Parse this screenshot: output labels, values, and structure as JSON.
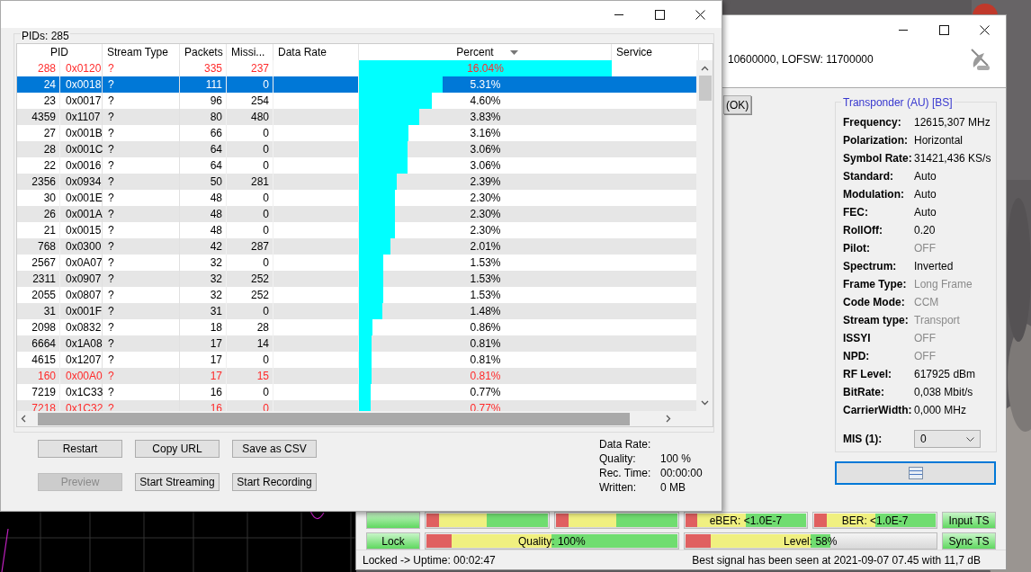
{
  "pid_window": {
    "group_label": "PIDs: 285",
    "columns": [
      {
        "label": "PID"
      },
      {
        "label": "Stream Type"
      },
      {
        "label": "Packets"
      },
      {
        "label": "Missi..."
      },
      {
        "label": "Data Rate"
      },
      {
        "label": "Percent",
        "sorted": true
      },
      {
        "label": "Service"
      }
    ],
    "rows": [
      {
        "pid": "288",
        "hex": "0x0120",
        "stream_type": "?",
        "packets": "335",
        "missing": "237",
        "percent": "16.04%",
        "level": 1,
        "alert": true,
        "selected": false
      },
      {
        "pid": "24",
        "hex": "0x0018",
        "stream_type": "?",
        "packets": "111",
        "missing": "0",
        "percent": "5.31%",
        "level": 0.331,
        "alert": false,
        "selected": true
      },
      {
        "pid": "23",
        "hex": "0x0017",
        "stream_type": "?",
        "packets": "96",
        "missing": "254",
        "percent": "4.60%",
        "level": 0.287,
        "alert": false,
        "selected": false
      },
      {
        "pid": "4359",
        "hex": "0x1107",
        "stream_type": "?",
        "packets": "80",
        "missing": "480",
        "percent": "3.83%",
        "level": 0.239,
        "alert": false,
        "selected": false
      },
      {
        "pid": "27",
        "hex": "0x001B",
        "stream_type": "?",
        "packets": "66",
        "missing": "0",
        "percent": "3.16%",
        "level": 0.197,
        "alert": false,
        "selected": false
      },
      {
        "pid": "28",
        "hex": "0x001C",
        "stream_type": "?",
        "packets": "64",
        "missing": "0",
        "percent": "3.06%",
        "level": 0.191,
        "alert": false,
        "selected": false
      },
      {
        "pid": "22",
        "hex": "0x0016",
        "stream_type": "?",
        "packets": "64",
        "missing": "0",
        "percent": "3.06%",
        "level": 0.191,
        "alert": false,
        "selected": false
      },
      {
        "pid": "2356",
        "hex": "0x0934",
        "stream_type": "?",
        "packets": "50",
        "missing": "281",
        "percent": "2.39%",
        "level": 0.149,
        "alert": false,
        "selected": false
      },
      {
        "pid": "30",
        "hex": "0x001E",
        "stream_type": "?",
        "packets": "48",
        "missing": "0",
        "percent": "2.30%",
        "level": 0.143,
        "alert": false,
        "selected": false
      },
      {
        "pid": "26",
        "hex": "0x001A",
        "stream_type": "?",
        "packets": "48",
        "missing": "0",
        "percent": "2.30%",
        "level": 0.143,
        "alert": false,
        "selected": false
      },
      {
        "pid": "21",
        "hex": "0x0015",
        "stream_type": "?",
        "packets": "48",
        "missing": "0",
        "percent": "2.30%",
        "level": 0.143,
        "alert": false,
        "selected": false
      },
      {
        "pid": "768",
        "hex": "0x0300",
        "stream_type": "?",
        "packets": "42",
        "missing": "287",
        "percent": "2.01%",
        "level": 0.125,
        "alert": false,
        "selected": false
      },
      {
        "pid": "2567",
        "hex": "0x0A07",
        "stream_type": "?",
        "packets": "32",
        "missing": "0",
        "percent": "1.53%",
        "level": 0.095,
        "alert": false,
        "selected": false
      },
      {
        "pid": "2311",
        "hex": "0x0907",
        "stream_type": "?",
        "packets": "32",
        "missing": "252",
        "percent": "1.53%",
        "level": 0.095,
        "alert": false,
        "selected": false
      },
      {
        "pid": "2055",
        "hex": "0x0807",
        "stream_type": "?",
        "packets": "32",
        "missing": "252",
        "percent": "1.53%",
        "level": 0.095,
        "alert": false,
        "selected": false
      },
      {
        "pid": "31",
        "hex": "0x001F",
        "stream_type": "?",
        "packets": "31",
        "missing": "0",
        "percent": "1.48%",
        "level": 0.092,
        "alert": false,
        "selected": false
      },
      {
        "pid": "2098",
        "hex": "0x0832",
        "stream_type": "?",
        "packets": "18",
        "missing": "28",
        "percent": "0.86%",
        "level": 0.054,
        "alert": false,
        "selected": false
      },
      {
        "pid": "6664",
        "hex": "0x1A08",
        "stream_type": "?",
        "packets": "17",
        "missing": "14",
        "percent": "0.81%",
        "level": 0.05,
        "alert": false,
        "selected": false
      },
      {
        "pid": "4615",
        "hex": "0x1207",
        "stream_type": "?",
        "packets": "17",
        "missing": "0",
        "percent": "0.81%",
        "level": 0.05,
        "alert": false,
        "selected": false
      },
      {
        "pid": "160",
        "hex": "0x00A0",
        "stream_type": "?",
        "packets": "17",
        "missing": "15",
        "percent": "0.81%",
        "level": 0.05,
        "alert": true,
        "selected": false
      },
      {
        "pid": "7219",
        "hex": "0x1C33",
        "stream_type": "?",
        "packets": "16",
        "missing": "0",
        "percent": "0.77%",
        "level": 0.048,
        "alert": false,
        "selected": false
      },
      {
        "pid": "7218",
        "hex": "0x1C32",
        "stream_type": "?",
        "packets": "16",
        "missing": "0",
        "percent": "0.77%",
        "level": 0.048,
        "alert": true,
        "selected": false
      }
    ],
    "buttons": [
      {
        "label": "Restart",
        "disabled": false
      },
      {
        "label": "Copy URL",
        "disabled": false
      },
      {
        "label": "Save as CSV",
        "disabled": false
      },
      {
        "label": "Preview",
        "disabled": true
      },
      {
        "label": "Start Streaming",
        "disabled": false
      },
      {
        "label": "Start Recording",
        "disabled": false
      }
    ],
    "info": [
      {
        "label": "Data Rate:"
      },
      {
        "label": "Quality:",
        "value": "100 %"
      },
      {
        "label": "Rec. Time:",
        "value": "00:00:00"
      },
      {
        "label": "Written:",
        "value": "0 MB"
      }
    ]
  },
  "tuner_window": {
    "lof_text": "10600000, LOFSW: 11700000",
    "ok_button": "(OK)",
    "transponder": {
      "title": "Transponder (AU) [BS]",
      "fields": [
        {
          "label": "Frequency:",
          "value": "12615,307 MHz",
          "dim": false
        },
        {
          "label": "Polarization:",
          "value": "Horizontal",
          "dim": false
        },
        {
          "label": "Symbol Rate:",
          "value": "31421,436 KS/s",
          "dim": false
        },
        {
          "label": "Standard:",
          "value": "Auto",
          "dim": false
        },
        {
          "label": "Modulation:",
          "value": "Auto",
          "dim": false
        },
        {
          "label": "FEC:",
          "value": "Auto",
          "dim": false
        },
        {
          "label": "RollOff:",
          "value": "0.20",
          "dim": false
        },
        {
          "label": "Pilot:",
          "value": "OFF",
          "dim": true
        },
        {
          "label": "Spectrum:",
          "value": "Inverted",
          "dim": false
        },
        {
          "label": "Frame Type:",
          "value": "Long Frame",
          "dim": true
        },
        {
          "label": "Code Mode:",
          "value": "CCM",
          "dim": true
        },
        {
          "label": "Stream type:",
          "value": "Transport",
          "dim": true
        },
        {
          "label": "ISSYI",
          "value": "OFF",
          "dim": true
        },
        {
          "label": "NPD:",
          "value": "OFF",
          "dim": true
        },
        {
          "label": "RF Level:",
          "value": "617925 dBm",
          "dim": false
        },
        {
          "label": "BitRate:",
          "value": "0,038 Mbit/s",
          "dim": false
        },
        {
          "label": "CarrierWidth:",
          "value": "0,000 MHz",
          "dim": false
        }
      ],
      "mis_label": "MIS (1):",
      "mis_value": "0"
    },
    "indicator_rows": [
      [
        {
          "kind": "indicator"
        },
        {
          "kind": "meter",
          "level": 1
        },
        {
          "kind": "meter",
          "level": 1
        },
        {
          "kind": "meter",
          "label": "eBER: <1.0E-7",
          "level": 1
        },
        {
          "kind": "meter",
          "label": "BER: <1.0E-7",
          "level": 1
        },
        {
          "kind": "indicator",
          "label": "Input TS"
        }
      ],
      [
        {
          "kind": "indicator",
          "label": "Lock"
        },
        {
          "kind": "meter",
          "label": "Quality: 100%",
          "level": 1
        },
        {
          "kind": "meter",
          "label": "Level: 58%",
          "level": 0.58
        },
        {
          "kind": "indicator",
          "label": "Sync TS"
        }
      ]
    ],
    "status_left": "Locked -> Uptime: 00:02:47",
    "status_right": "Best signal has been seen at 2021-09-07 07.45 with 11,7 dB"
  }
}
